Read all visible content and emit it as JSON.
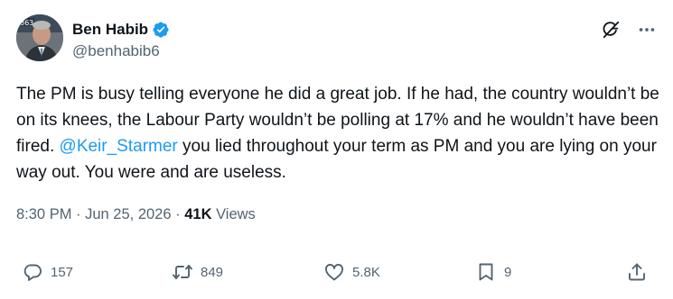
{
  "author": {
    "display_name": "Ben Habib",
    "handle": "@benhabib6",
    "verified": true,
    "avatar_badge_text": "863"
  },
  "tweet": {
    "text_before_mention": "The PM is busy telling everyone he did a great job. If he had, the country wouldn’t be on its knees, the Labour Party wouldn’t be polling at 17% and he wouldn’t have been fired.  ",
    "mention": "@Keir_Starmer",
    "text_after_mention": " you lied throughout your term as PM and you are lying on your way out.  You were and are useless."
  },
  "meta": {
    "time": "8:30 PM",
    "separator1": " · ",
    "date": "Jun 25, 2026",
    "separator2": " · ",
    "views_count": "41K",
    "views_label": " Views"
  },
  "actions": {
    "replies": "157",
    "reposts": "849",
    "likes": "5.8K",
    "bookmarks": "9"
  },
  "colors": {
    "accent": "#1d9bf0",
    "text": "#0f1419",
    "secondary": "#536471"
  },
  "icons": [
    "verified-badge-icon",
    "grok-icon",
    "more-icon",
    "reply-icon",
    "repost-icon",
    "like-icon",
    "bookmark-icon",
    "share-icon"
  ]
}
